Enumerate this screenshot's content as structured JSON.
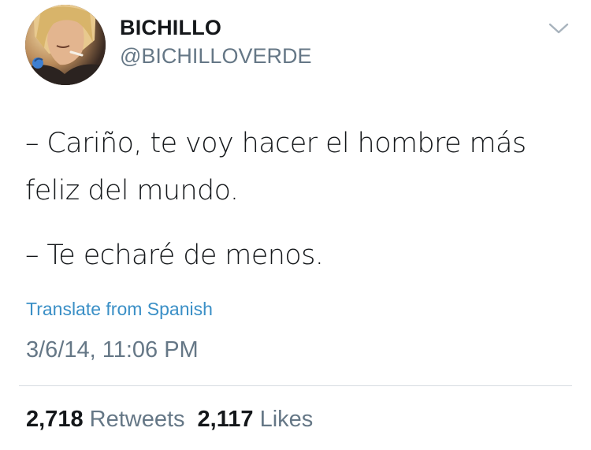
{
  "author": {
    "name": "BICHILLO",
    "handle": "@BICHILLOVERDE"
  },
  "tweet": {
    "line1": "– Cariño, te voy hacer el hombre más feliz del mundo.",
    "line2": "– Te echaré de menos.",
    "translate_label": "Translate from Spanish",
    "timestamp": "3/6/14, 11:06 PM"
  },
  "stats": {
    "retweets_count": "2,718",
    "retweets_label": "Retweets",
    "likes_count": "2,117",
    "likes_label": "Likes"
  },
  "icons": {
    "menu": "chevron-down-icon"
  },
  "colors": {
    "link": "#3a8fc6",
    "secondary_text": "#657786",
    "primary_text": "#14171a",
    "divider": "#d6dce1"
  }
}
